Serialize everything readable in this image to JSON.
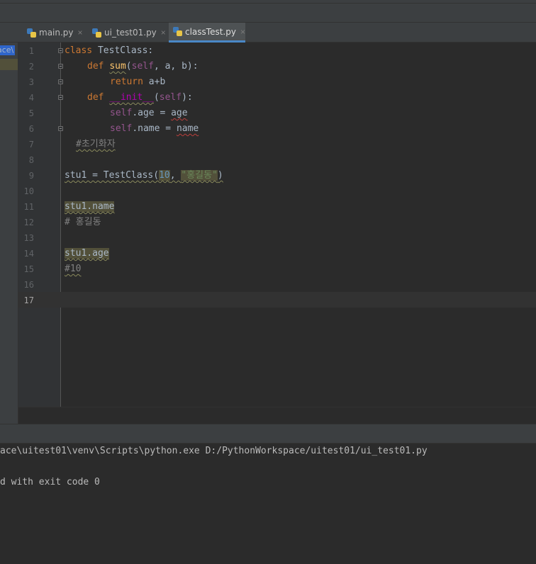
{
  "project_panel": {
    "crumb": "ace\\"
  },
  "tabs": [
    {
      "label": "main.py",
      "close": "×",
      "active": false
    },
    {
      "label": "ui_test01.py",
      "close": "×",
      "active": false
    },
    {
      "label": "classTest.py",
      "close": "×",
      "active": true
    }
  ],
  "editor": {
    "line_numbers": [
      "1",
      "2",
      "3",
      "4",
      "5",
      "6",
      "7",
      "8",
      "9",
      "10",
      "11",
      "12",
      "13",
      "14",
      "15",
      "16",
      "17"
    ],
    "current_line": "17",
    "code": {
      "l1": {
        "kw": "class",
        "rest": " TestClass:"
      },
      "l2": {
        "kw": "def",
        "fn": "sum",
        "open": "(",
        "self": "self",
        "rest": ", a, b):"
      },
      "l3": {
        "kw": "return",
        "rest": " a+b"
      },
      "l4": {
        "kw": "def",
        "fn": "__init__",
        "open": "(",
        "self": "self",
        "rest": "):"
      },
      "l5": {
        "self": "self",
        "mid": ".age = ",
        "var": "age"
      },
      "l6": {
        "self": "self",
        "mid": ".name = ",
        "var": "name"
      },
      "l7": {
        "comment": "#초기화자"
      },
      "l9": {
        "pre": "stu1 = TestClass(",
        "num": "10",
        "sep": ", ",
        "str": "\"홍길동\"",
        "post": ")"
      },
      "l11": {
        "text": "stu1.name"
      },
      "l12": {
        "comment": "# 홍길동"
      },
      "l14": {
        "text": "stu1.age"
      },
      "l15": {
        "comment": "#10"
      }
    }
  },
  "console": {
    "lines": [
      "ace\\uitest01\\venv\\Scripts\\python.exe D:/PythonWorkspace/uitest01/ui_test01.py",
      "",
      "d with exit code 0"
    ]
  },
  "colors": {
    "keyword": "#cc7832",
    "function": "#ffc66d",
    "self": "#94558d",
    "number": "#6897bb",
    "string": "#6a8759",
    "comment": "#808080",
    "tab_accent": "#4a88c7"
  },
  "icons": {
    "tab_file": "python-file-icon",
    "panel_toggle": "minus-icon",
    "fold": "fold-marker-icon"
  }
}
